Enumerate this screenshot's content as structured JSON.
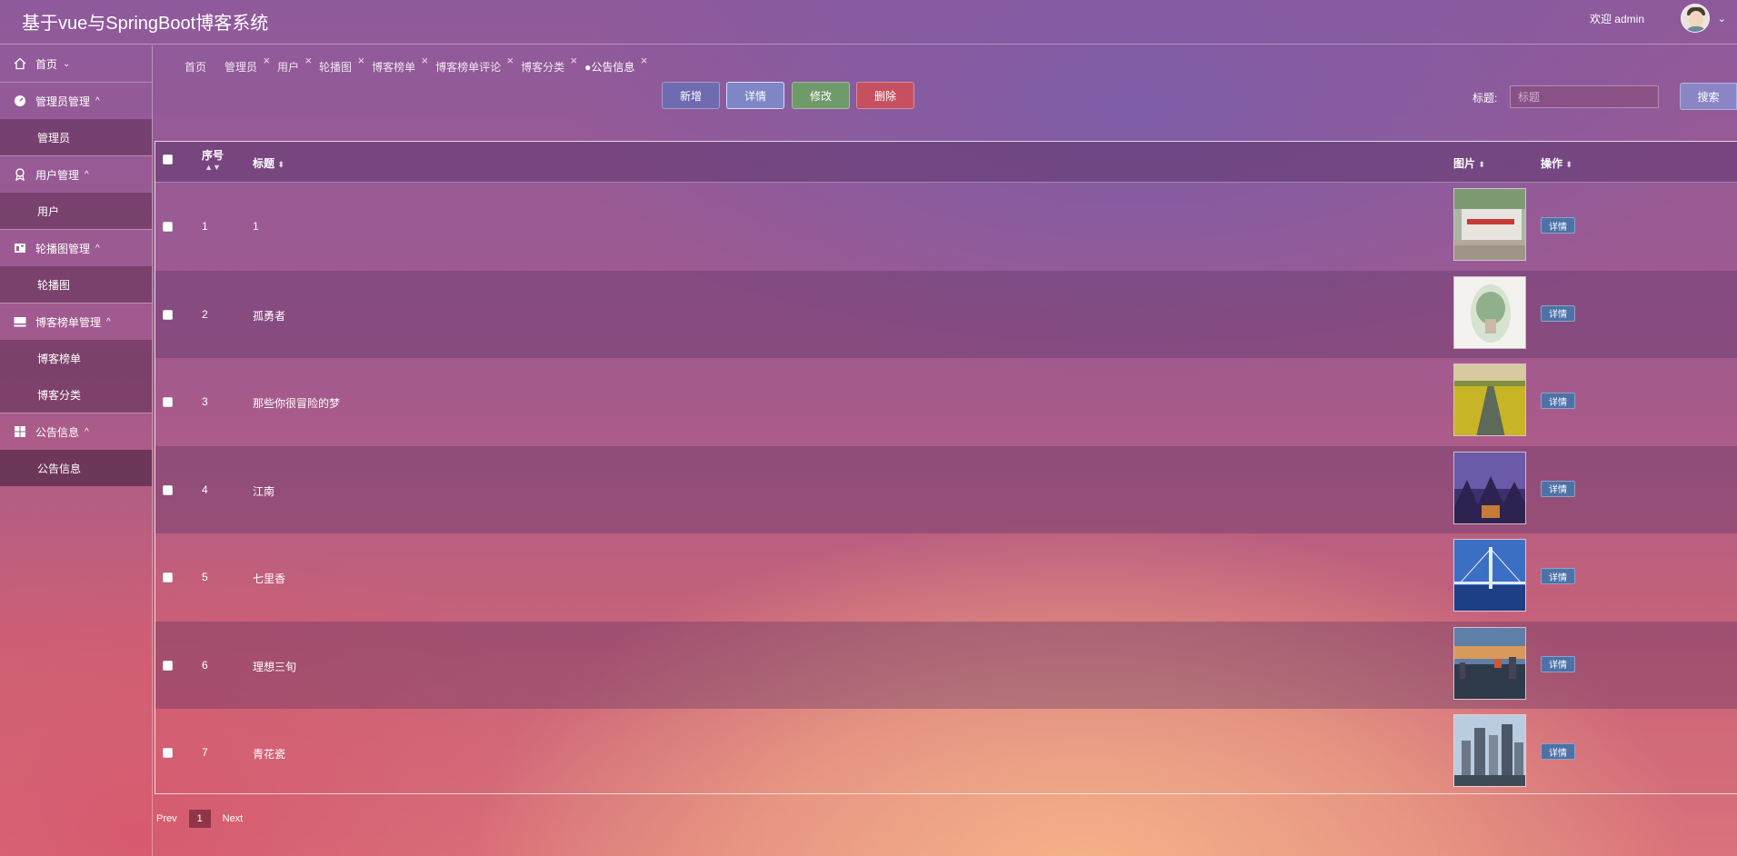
{
  "header": {
    "title": "基于vue与SpringBoot博客系统",
    "welcome": "欢迎 admin"
  },
  "sidebar": {
    "groups": [
      {
        "label": "首页",
        "icon": "home-icon",
        "caret": "⌄",
        "children": []
      },
      {
        "label": "管理员管理",
        "icon": "dashboard-icon",
        "caret": "^",
        "children": [
          {
            "label": "管理员"
          }
        ]
      },
      {
        "label": "用户管理",
        "icon": "user-badge-icon",
        "caret": "^",
        "children": [
          {
            "label": "用户"
          }
        ]
      },
      {
        "label": "轮播图管理",
        "icon": "carousel-icon",
        "caret": "^",
        "children": [
          {
            "label": "轮播图"
          }
        ]
      },
      {
        "label": "博客榜单管理",
        "icon": "list-icon",
        "caret": "^",
        "children": [
          {
            "label": "博客榜单"
          },
          {
            "label": "博客分类"
          }
        ]
      },
      {
        "label": "公告信息",
        "icon": "grid-icon",
        "caret": "^",
        "children": [
          {
            "label": "公告信息"
          }
        ]
      }
    ]
  },
  "tabs": [
    {
      "label": "首页"
    },
    {
      "label": "管理员"
    },
    {
      "label": "用户"
    },
    {
      "label": "轮播图"
    },
    {
      "label": "博客榜单"
    },
    {
      "label": "博客榜单评论"
    },
    {
      "label": "博客分类"
    },
    {
      "label": "●公告信息"
    }
  ],
  "toolbar": {
    "add": "新增",
    "detail": "详情",
    "edit": "修改",
    "delete": "删除",
    "search_label": "标题:",
    "search_placeholder": "标题",
    "search_button": "搜索"
  },
  "table": {
    "headers": {
      "index": "序号",
      "title": "标题",
      "image": "图片",
      "action": "操作"
    },
    "row_button": "详情",
    "rows": [
      {
        "index": "1",
        "title": "1"
      },
      {
        "index": "2",
        "title": "孤勇者"
      },
      {
        "index": "3",
        "title": "那些你很冒险的梦"
      },
      {
        "index": "4",
        "title": "江南"
      },
      {
        "index": "5",
        "title": "七里香"
      },
      {
        "index": "6",
        "title": "理想三旬"
      },
      {
        "index": "7",
        "title": "青花瓷"
      }
    ]
  },
  "pagination": {
    "prev": "Prev",
    "current": "1",
    "next": "Next"
  }
}
